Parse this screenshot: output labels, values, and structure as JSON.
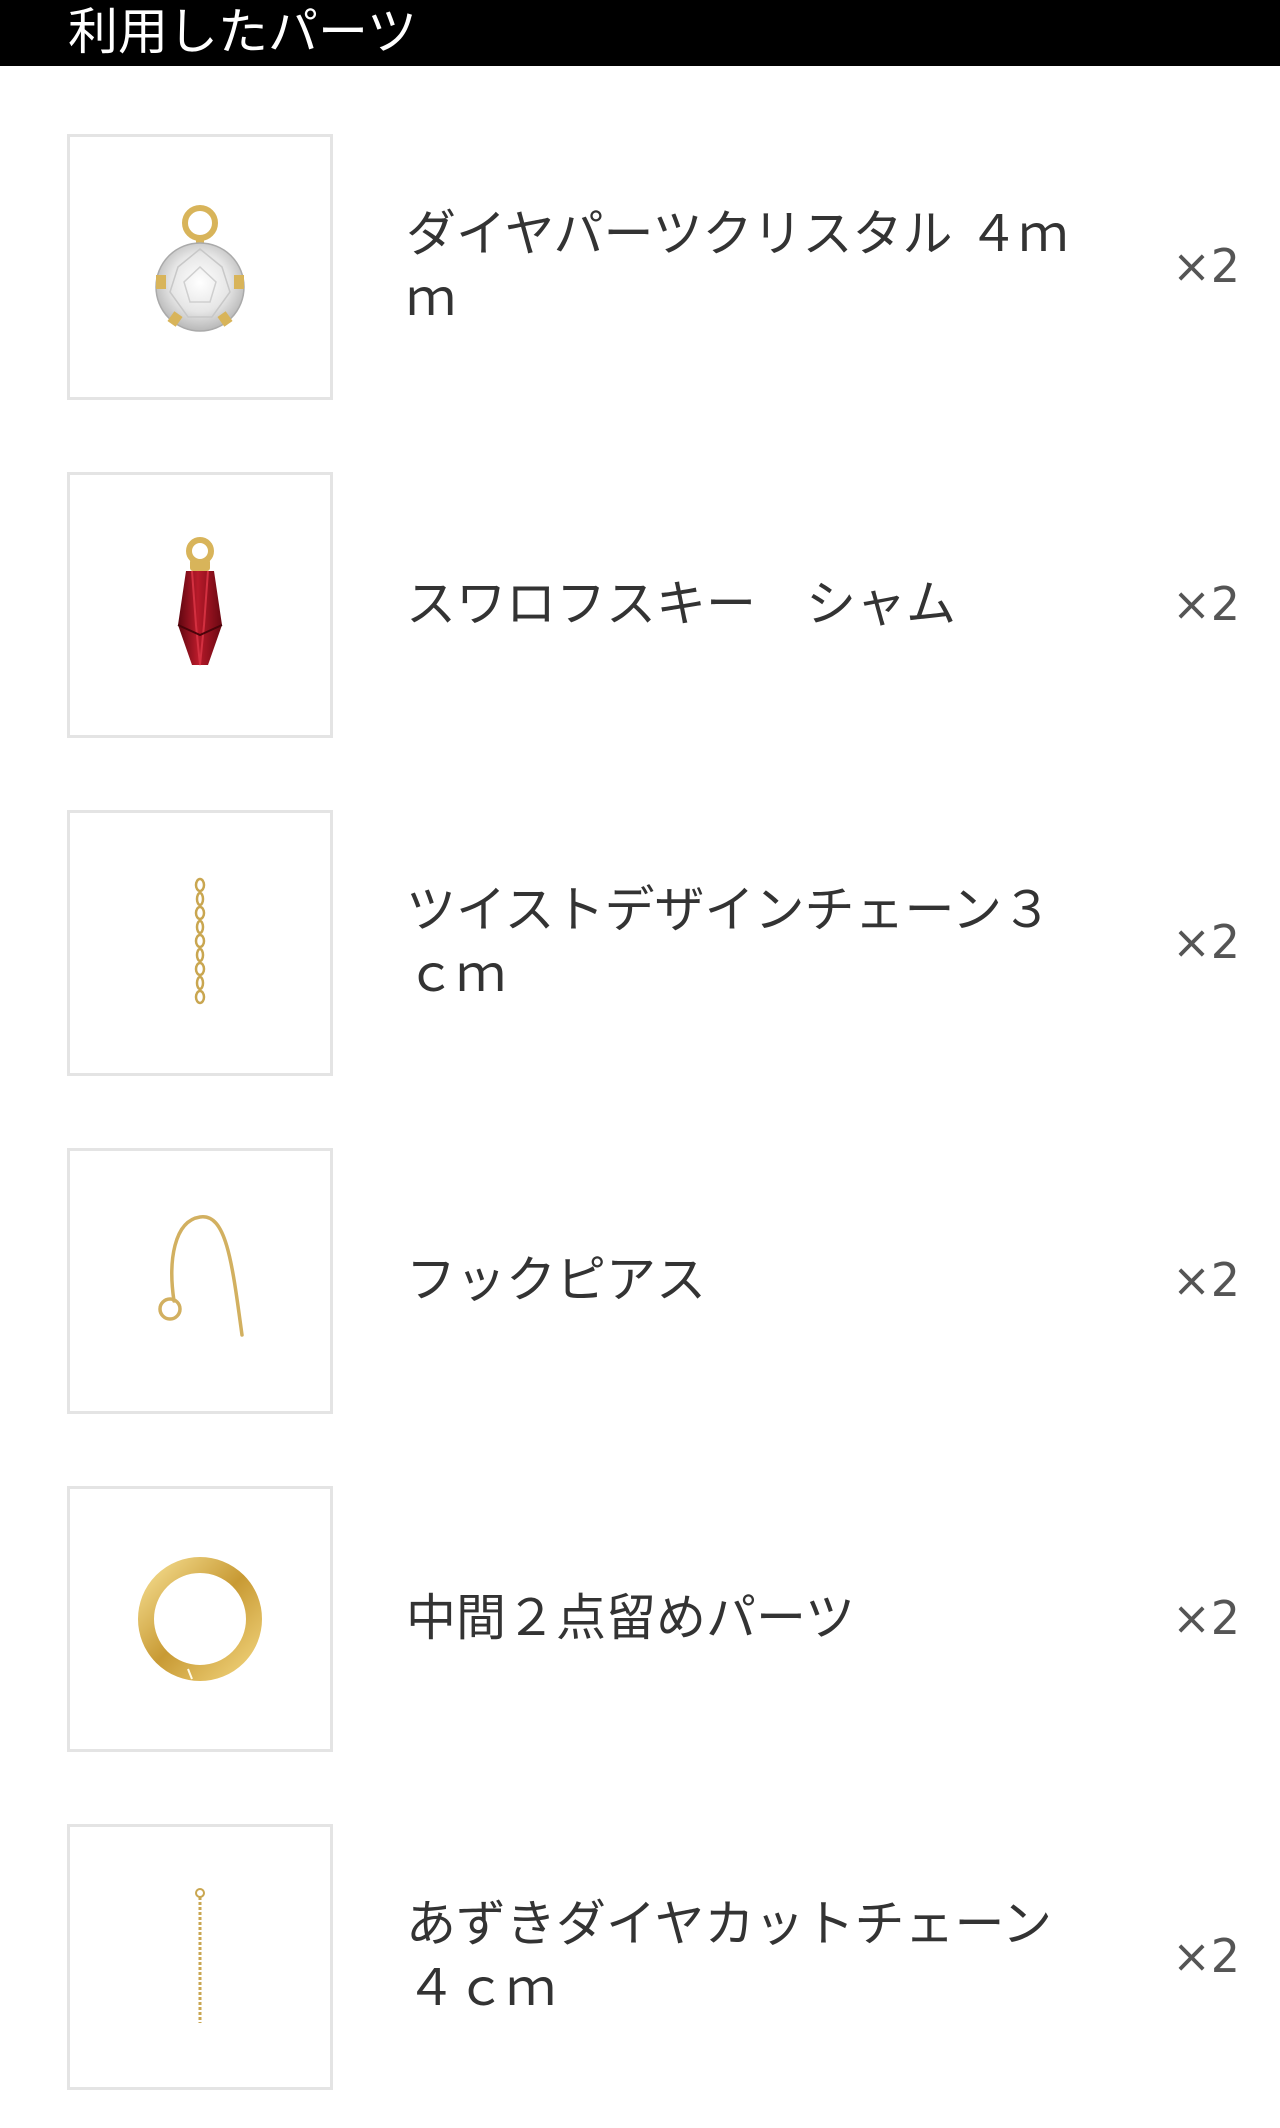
{
  "header": {
    "title": "利用したパーツ"
  },
  "colors": {
    "header_bg": "#000000",
    "header_text": "#ffffff",
    "thumb_border": "#e4e4e4",
    "gold": "#d8b45a",
    "ruby": "#9e1020"
  },
  "parts": [
    {
      "name": "ダイヤパーツクリスタル ４ｍｍ",
      "qty": "×2",
      "icon": "crystal-charm-icon"
    },
    {
      "name": "スワロフスキー　シャム",
      "qty": "×2",
      "icon": "red-drop-charm-icon"
    },
    {
      "name": "ツイストデザインチェーン３ｃｍ",
      "qty": "×2",
      "icon": "twist-chain-icon"
    },
    {
      "name": "フックピアス",
      "qty": "×2",
      "icon": "hook-earring-icon"
    },
    {
      "name": "中間２点留めパーツ",
      "qty": "×2",
      "icon": "gold-ring-icon"
    },
    {
      "name": "あずきダイヤカットチェーン４ｃｍ",
      "qty": "×2",
      "icon": "azuki-chain-icon"
    }
  ]
}
